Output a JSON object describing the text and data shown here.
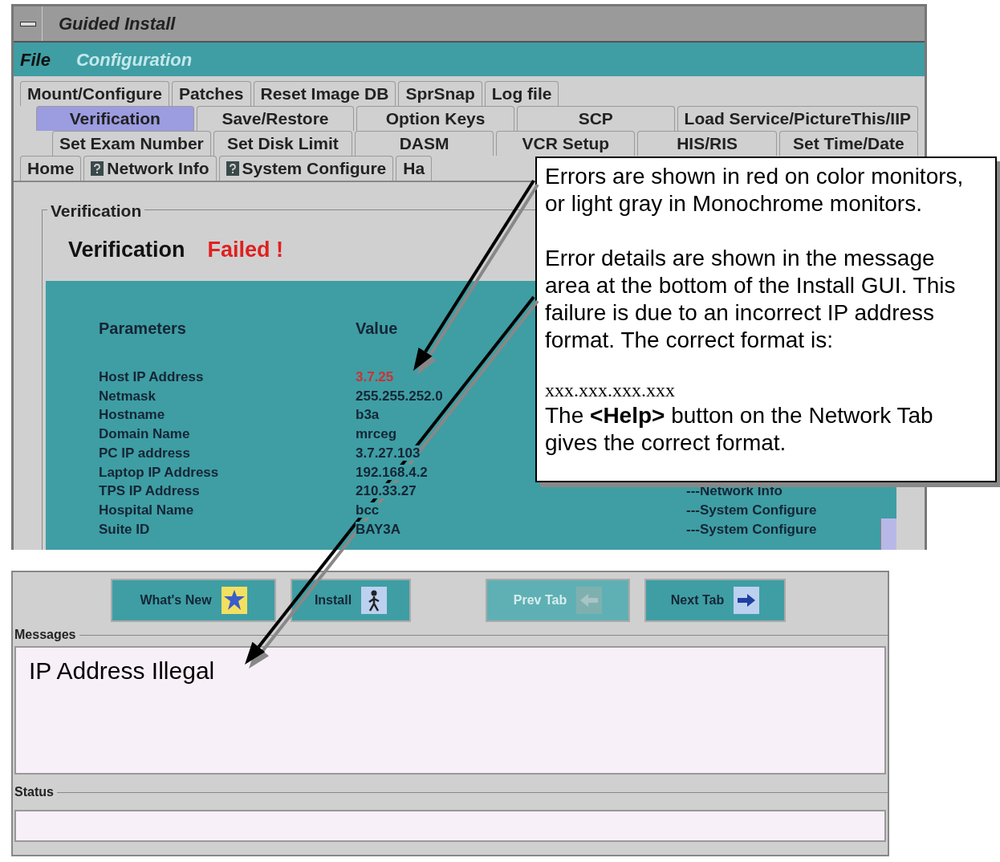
{
  "window": {
    "title": "Guided Install"
  },
  "menu": [
    {
      "label": "File",
      "disabled": false
    },
    {
      "label": "Configuration",
      "disabled": true
    }
  ],
  "tab_rows": [
    [
      {
        "label": "Mount/Configure",
        "selected": false,
        "kind": "plain"
      },
      {
        "label": "Patches",
        "selected": false,
        "kind": "plain"
      },
      {
        "label": "Reset Image DB",
        "selected": false,
        "kind": "plain"
      },
      {
        "label": "SprSnap",
        "selected": false,
        "kind": "plain"
      },
      {
        "label": "Log file",
        "selected": false,
        "kind": "plain"
      }
    ],
    [
      {
        "label": "Verification",
        "selected": true,
        "kind": "plain"
      },
      {
        "label": "Save/Restore",
        "selected": false,
        "kind": "plain"
      },
      {
        "label": "Option Keys",
        "selected": false,
        "kind": "plain"
      },
      {
        "label": "SCP",
        "selected": false,
        "kind": "plain"
      },
      {
        "label": "Load Service/PictureThis/IIP",
        "selected": false,
        "kind": "plain"
      }
    ],
    [
      {
        "label": "Set Exam Number",
        "selected": false,
        "kind": "plain"
      },
      {
        "label": "Set Disk Limit",
        "selected": false,
        "kind": "plain"
      },
      {
        "label": "DASM",
        "selected": false,
        "kind": "plain"
      },
      {
        "label": "VCR Setup",
        "selected": false,
        "kind": "plain"
      },
      {
        "label": "HIS/RIS",
        "selected": false,
        "kind": "plain"
      },
      {
        "label": "Set Time/Date",
        "selected": false,
        "kind": "plain"
      }
    ],
    [
      {
        "label": "Home",
        "selected": false,
        "kind": "plain"
      },
      {
        "label": "Network Info",
        "selected": false,
        "kind": "help"
      },
      {
        "label": "System Configure",
        "selected": false,
        "kind": "help"
      },
      {
        "label": "Ha",
        "selected": false,
        "kind": "plain"
      }
    ]
  ],
  "verification": {
    "group_label": "Verification",
    "heading": "Verification",
    "result": "Failed !",
    "columns": [
      "Parameters",
      "Value"
    ],
    "rows": [
      {
        "parameter": "Host IP Address",
        "value": "3.7.25",
        "error": true
      },
      {
        "parameter": "Netmask",
        "value": "255.255.252.0",
        "error": false
      },
      {
        "parameter": "Hostname",
        "value": "b3a",
        "error": false
      },
      {
        "parameter": "Domain Name",
        "value": "mrceg",
        "error": false
      },
      {
        "parameter": "PC IP address",
        "value": "3.7.27.103",
        "error": false
      },
      {
        "parameter": "Laptop IP Address",
        "value": "192.168.4.2",
        "error": false
      },
      {
        "parameter": "TPS IP Address",
        "value": "210.33.27",
        "error": false,
        "source": "---Network Info"
      },
      {
        "parameter": "Hospital Name",
        "value": "bcc",
        "error": false,
        "source": "---System Configure"
      },
      {
        "parameter": "Suite ID",
        "value": "BAY3A",
        "error": false,
        "source": "---System Configure"
      }
    ]
  },
  "buttons": [
    {
      "label": "What's New",
      "disabled": false,
      "kind": "new"
    },
    {
      "label": "Install",
      "disabled": false,
      "kind": "install"
    },
    {
      "label": "Prev Tab",
      "disabled": true,
      "kind": "prev"
    },
    {
      "label": "Next Tab",
      "disabled": false,
      "kind": "next"
    }
  ],
  "messages": {
    "label": "Messages",
    "text": "IP Address Illegal"
  },
  "status": {
    "label": "Status"
  },
  "callout": {
    "paragraphs": [
      "Errors are shown in red on color monitors, or light gray in Monochrome monitors.",
      "Error details are shown in the message area at the bottom of the Install GUI. This failure is due to an incorrect IP address format. The correct format is:"
    ],
    "format": "xxx.xxx.xxx.xxx",
    "note": "The **<Help>** button on the Network Tab gives the correct format."
  }
}
